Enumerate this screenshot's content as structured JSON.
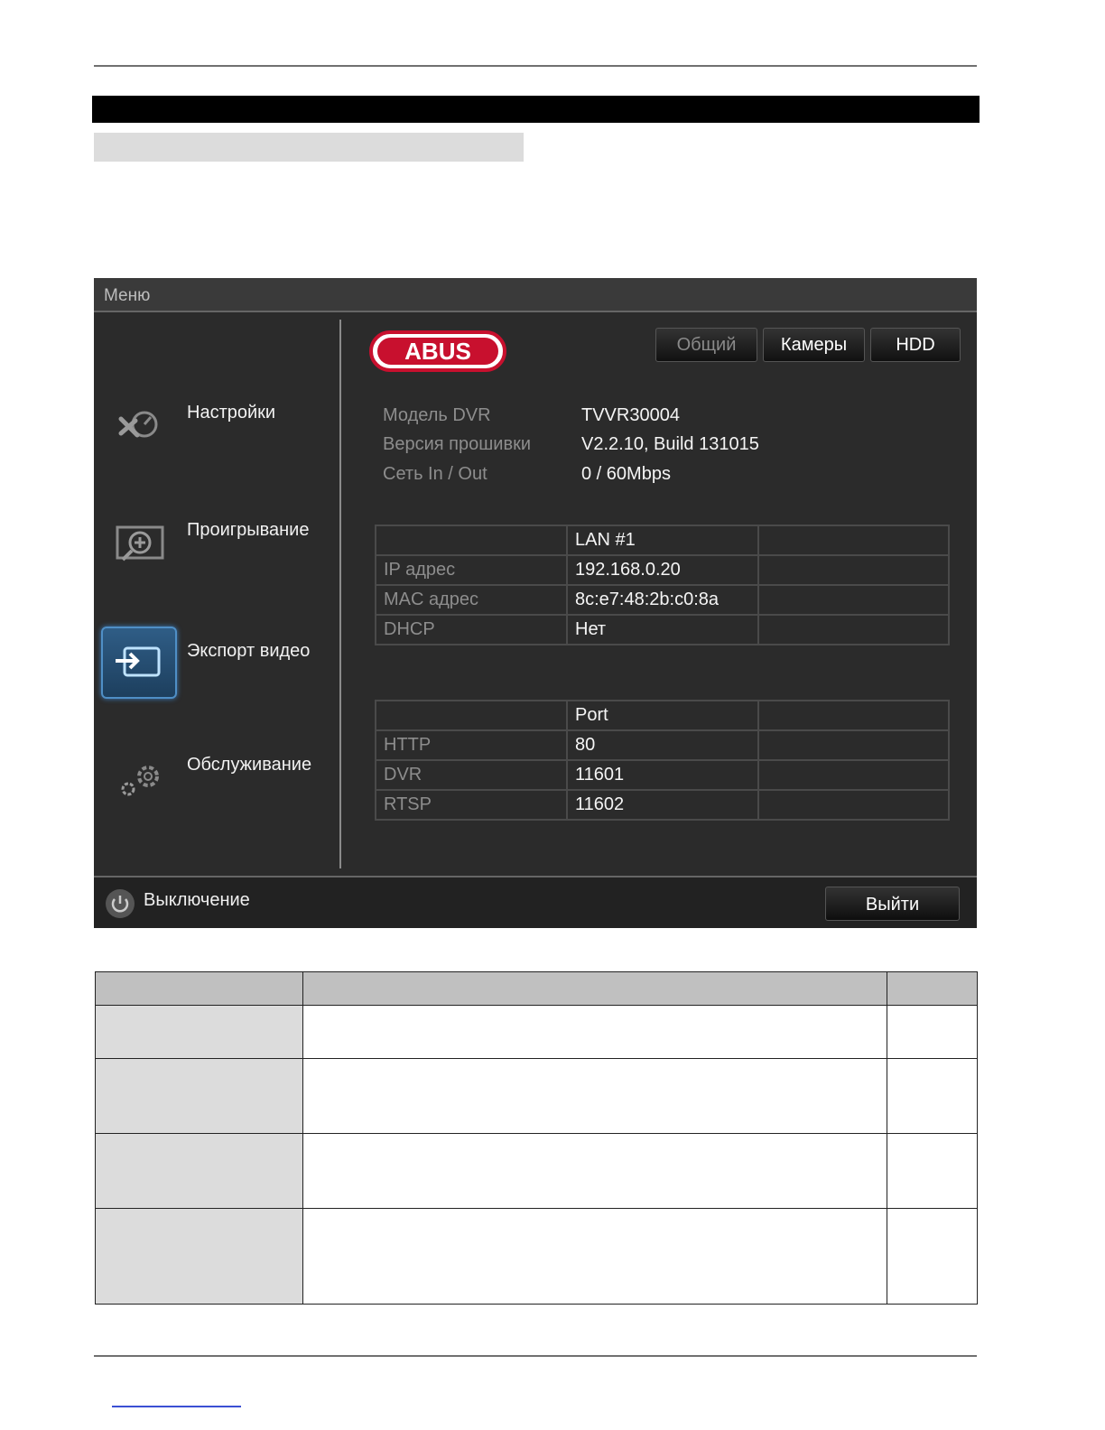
{
  "dvr": {
    "window_title": "Меню",
    "sidebar": {
      "items": [
        {
          "label": "Настройки",
          "icon": "settings-tools-icon"
        },
        {
          "label": "Проигрывание",
          "icon": "playback-film-icon"
        },
        {
          "label": "Экспорт видео",
          "icon": "export-folder-icon",
          "active": true
        },
        {
          "label": "Обслуживание",
          "icon": "gears-icon"
        }
      ]
    },
    "logo_text": "ABUS",
    "tabs": [
      {
        "label": "Общий",
        "active": false
      },
      {
        "label": "Камеры",
        "active": true
      },
      {
        "label": "HDD",
        "active": true
      }
    ],
    "info": [
      {
        "label": "Модель DVR",
        "value": "TVVR30004"
      },
      {
        "label": "Версия прошивки",
        "value": "V2.2.10, Build 131015"
      },
      {
        "label": "Сеть In / Out",
        "value": "0 / 60Mbps"
      }
    ],
    "lan_table": {
      "header": [
        "",
        "LAN #1",
        ""
      ],
      "rows": [
        [
          "IP адрес",
          "192.168.0.20",
          ""
        ],
        [
          "MAC адрес",
          "8c:e7:48:2b:c0:8a",
          ""
        ],
        [
          "DHCP",
          "Нет",
          ""
        ]
      ]
    },
    "port_table": {
      "header": [
        "",
        "Port",
        ""
      ],
      "rows": [
        [
          "HTTP",
          "80",
          ""
        ],
        [
          "DVR",
          "11601",
          ""
        ],
        [
          "RTSP",
          "11602",
          ""
        ]
      ]
    },
    "shutdown_label": "Выключение",
    "exit_label": "Выйти"
  },
  "colors": {
    "screen_bg": "#2b2b2b",
    "logo_red": "#c8102e",
    "active_blue": "#3b7dbf"
  }
}
